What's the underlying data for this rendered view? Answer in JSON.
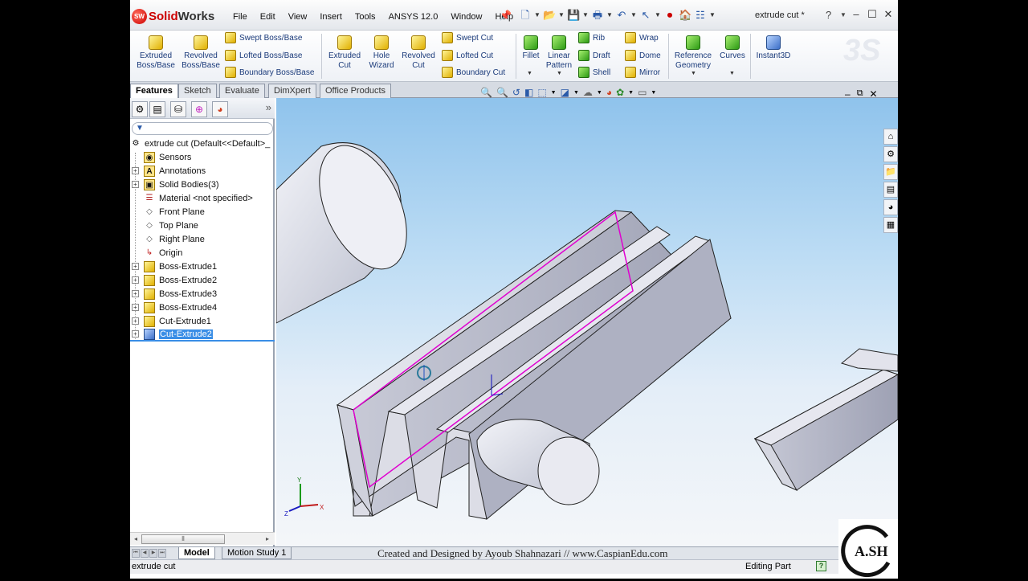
{
  "app": {
    "brand_prefix": "Solid",
    "brand_suffix": "Works",
    "logo_badge": "SW",
    "document_title": "extrude cut *"
  },
  "menu": [
    "File",
    "Edit",
    "View",
    "Insert",
    "Tools",
    "ANSYS 12.0",
    "Window",
    "Help"
  ],
  "ribbon": {
    "extruded_boss": "Extruded\nBoss/Base",
    "revolved_boss": "Revolved\nBoss/Base",
    "swept_boss": "Swept Boss/Base",
    "lofted_boss": "Lofted Boss/Base",
    "boundary_boss": "Boundary Boss/Base",
    "extruded_cut": "Extruded\nCut",
    "hole_wizard": "Hole\nWizard",
    "revolved_cut": "Revolved\nCut",
    "swept_cut": "Swept Cut",
    "lofted_cut": "Lofted Cut",
    "boundary_cut": "Boundary Cut",
    "fillet": "Fillet",
    "linear_pattern": "Linear\nPattern",
    "rib": "Rib",
    "draft": "Draft",
    "shell": "Shell",
    "wrap": "Wrap",
    "dome": "Dome",
    "mirror": "Mirror",
    "reference_geometry": "Reference\nGeometry",
    "curves": "Curves",
    "instant3d": "Instant3D"
  },
  "command_tabs": [
    "Features",
    "Sketch",
    "Evaluate",
    "DimXpert",
    "Office Products"
  ],
  "tree": {
    "root": "extrude cut  (Default<<Default>_",
    "items": [
      "Sensors",
      "Annotations",
      "Solid Bodies(3)",
      "Material <not specified>",
      "Front Plane",
      "Top Plane",
      "Right Plane",
      "Origin",
      "Boss-Extrude1",
      "Boss-Extrude2",
      "Boss-Extrude3",
      "Boss-Extrude4",
      "Cut-Extrude1",
      "Cut-Extrude2"
    ],
    "selected": "Cut-Extrude2"
  },
  "bottom_tabs": [
    "Model",
    "Motion Study 1"
  ],
  "credit": "Created and Designed by Ayoub Shahnazari  //  www.CaspianEdu.com",
  "status": {
    "left": "extrude cut",
    "mode": "Editing Part",
    "help": "?"
  },
  "triad": {
    "x": "X",
    "y": "Y",
    "z": "Z"
  },
  "watermark": {
    "letters": "A.SH"
  },
  "colors": {
    "selection": "#3a8ee6",
    "edge_highlight": "#e000d0",
    "viewport_top": "#8fc3ec",
    "viewport_bottom": "#f4f6f9"
  },
  "icons": {
    "zoom": "zoom-to-fit-icon",
    "rotate": "rotate-view-icon",
    "section": "section-view-icon",
    "display": "display-style-icon",
    "appearance": "edit-appearance-icon"
  }
}
